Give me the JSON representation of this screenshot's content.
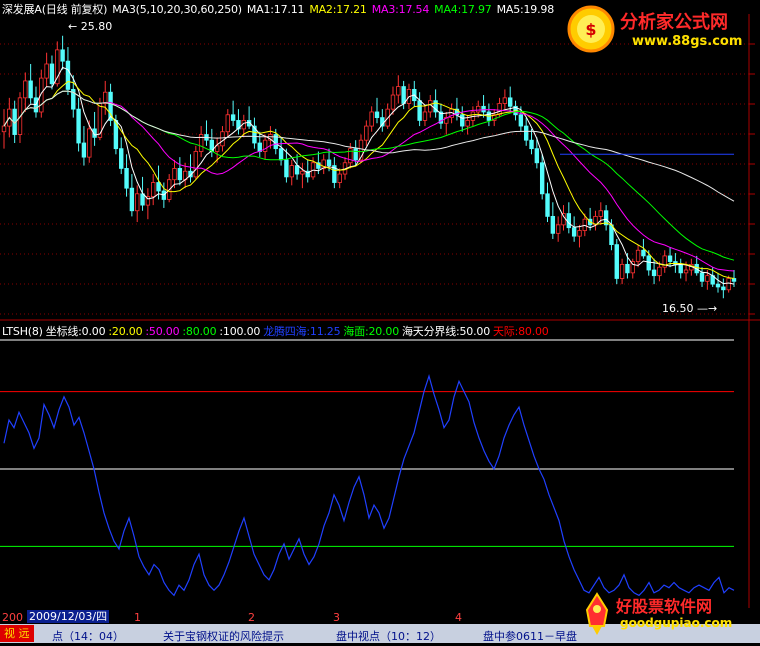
{
  "header": {
    "stock": "深发展A(日线 前复权)",
    "ma_params": "MA3(5,10,20,30,60,250)",
    "ma1": "MA1:17.11",
    "ma2": "MA2:17.21",
    "ma3": "MA3:17.54",
    "ma4": "MA4:17.97",
    "ma5": "MA5:19.98"
  },
  "indicator_header": {
    "name": "LTSH(8)",
    "coord": "坐标线:0.00",
    "c20": ":20.00",
    "c50": ":50.00",
    "c80": ":80.00",
    "c100": ":100.00",
    "longteng": "龙腾四海:11.25",
    "haimian": "海面:20.00",
    "fenjie": "海天分界线:50.00",
    "tianji": "天际:80.00"
  },
  "annotations": {
    "high": "25.80",
    "low": "16.50"
  },
  "colors": {
    "ma1": "#ffffff",
    "ma2": "#ffff00",
    "ma3": "#ff00ff",
    "ma4": "#00ff00",
    "ma5": "#ffffff",
    "up": "#ff3232",
    "down": "#54fcfc",
    "ltsh": "#2040ff",
    "haimian": "#00ff00",
    "fenjie": "#ffffff",
    "tianji": "#ff0000"
  },
  "bottom": {
    "year": "200",
    "date": "2009/12/03/四",
    "months": [
      "1",
      "2",
      "3",
      "4"
    ],
    "tab": "视 远",
    "news": [
      "点（14：04）",
      "关于宝钢权证的风险提示",
      "盘中视点（10：12）",
      "盘中参0611－早盘"
    ]
  },
  "logos": {
    "top_title": "分析家公式网",
    "top_url": "www.88gs.com",
    "bottom_title": "好股票软件网",
    "bottom_url": "goodgupiao.com"
  },
  "chart_data": [
    {
      "type": "candlestick",
      "title": "",
      "ylim": [
        15.8,
        26.5
      ],
      "candles_ohlc": [
        [
          22.4,
          23.2,
          21.8,
          22.6
        ],
        [
          22.6,
          23.6,
          22.2,
          23.2
        ],
        [
          23.2,
          23.5,
          22.0,
          22.3
        ],
        [
          22.3,
          23.8,
          22.0,
          23.6
        ],
        [
          23.6,
          24.5,
          23.1,
          24.2
        ],
        [
          24.2,
          24.8,
          23.4,
          23.6
        ],
        [
          23.6,
          24.0,
          22.9,
          23.1
        ],
        [
          23.1,
          24.6,
          22.9,
          24.3
        ],
        [
          24.3,
          25.2,
          24.0,
          24.8
        ],
        [
          24.8,
          25.1,
          23.9,
          24.1
        ],
        [
          24.1,
          25.6,
          24.0,
          25.3
        ],
        [
          25.3,
          25.8,
          24.6,
          24.9
        ],
        [
          24.9,
          25.4,
          23.7,
          23.9
        ],
        [
          23.9,
          24.4,
          22.9,
          23.2
        ],
        [
          23.2,
          23.6,
          21.7,
          22.0
        ],
        [
          22.0,
          22.6,
          21.2,
          21.5
        ],
        [
          21.5,
          22.8,
          21.3,
          22.5
        ],
        [
          22.5,
          23.1,
          21.9,
          22.2
        ],
        [
          22.2,
          23.6,
          22.1,
          23.4
        ],
        [
          23.4,
          24.2,
          23.0,
          23.8
        ],
        [
          23.8,
          24.1,
          22.6,
          22.8
        ],
        [
          22.8,
          23.0,
          21.6,
          21.8
        ],
        [
          21.8,
          22.2,
          20.9,
          21.1
        ],
        [
          21.1,
          21.6,
          20.1,
          20.4
        ],
        [
          20.4,
          20.9,
          19.4,
          19.6
        ],
        [
          19.6,
          20.5,
          19.2,
          20.2
        ],
        [
          20.2,
          20.8,
          19.6,
          19.8
        ],
        [
          19.8,
          20.4,
          19.3,
          20.1
        ],
        [
          20.1,
          20.9,
          19.8,
          20.6
        ],
        [
          20.6,
          21.2,
          20.0,
          20.3
        ],
        [
          20.3,
          20.6,
          19.7,
          20.0
        ],
        [
          20.0,
          20.9,
          19.9,
          20.7
        ],
        [
          20.7,
          21.4,
          20.4,
          21.1
        ],
        [
          21.1,
          21.5,
          20.5,
          20.7
        ],
        [
          20.7,
          21.3,
          20.4,
          21.0
        ],
        [
          21.0,
          21.6,
          20.6,
          20.8
        ],
        [
          20.8,
          21.9,
          20.7,
          21.7
        ],
        [
          21.7,
          22.6,
          21.5,
          22.3
        ],
        [
          22.3,
          22.8,
          21.9,
          22.1
        ],
        [
          22.1,
          22.5,
          21.5,
          21.7
        ],
        [
          21.7,
          22.2,
          21.3,
          21.9
        ],
        [
          21.9,
          22.6,
          21.7,
          22.4
        ],
        [
          22.4,
          23.2,
          22.2,
          23.0
        ],
        [
          23.0,
          23.5,
          22.6,
          22.8
        ],
        [
          22.8,
          23.2,
          22.3,
          22.5
        ],
        [
          22.5,
          23.0,
          22.2,
          22.8
        ],
        [
          22.8,
          23.3,
          22.5,
          22.6
        ],
        [
          22.6,
          22.9,
          21.8,
          22.0
        ],
        [
          22.0,
          22.4,
          21.5,
          21.7
        ],
        [
          21.7,
          22.3,
          21.4,
          22.1
        ],
        [
          22.1,
          22.6,
          21.8,
          22.3
        ],
        [
          22.3,
          22.5,
          21.6,
          21.8
        ],
        [
          21.8,
          22.2,
          21.2,
          21.4
        ],
        [
          21.4,
          21.8,
          20.6,
          20.8
        ],
        [
          20.8,
          21.4,
          20.5,
          21.2
        ],
        [
          21.2,
          21.6,
          20.7,
          20.9
        ],
        [
          20.9,
          21.3,
          20.4,
          21.0
        ],
        [
          21.0,
          21.4,
          20.6,
          20.8
        ],
        [
          20.8,
          21.5,
          20.7,
          21.3
        ],
        [
          21.3,
          21.7,
          20.9,
          21.1
        ],
        [
          21.1,
          21.6,
          20.9,
          21.4
        ],
        [
          21.4,
          21.8,
          21.0,
          21.2
        ],
        [
          21.2,
          21.5,
          20.4,
          20.6
        ],
        [
          20.6,
          21.1,
          20.4,
          20.9
        ],
        [
          20.9,
          21.5,
          20.7,
          21.3
        ],
        [
          21.3,
          22.0,
          21.1,
          21.8
        ],
        [
          21.8,
          22.1,
          21.2,
          21.4
        ],
        [
          21.4,
          22.3,
          21.3,
          22.1
        ],
        [
          22.1,
          22.8,
          21.9,
          22.6
        ],
        [
          22.6,
          23.3,
          22.4,
          23.1
        ],
        [
          23.1,
          23.6,
          22.7,
          22.9
        ],
        [
          22.9,
          23.2,
          22.4,
          22.6
        ],
        [
          22.6,
          23.4,
          22.5,
          23.2
        ],
        [
          23.2,
          24.0,
          23.0,
          23.7
        ],
        [
          23.7,
          24.4,
          23.4,
          24.0
        ],
        [
          24.0,
          24.2,
          23.2,
          23.4
        ],
        [
          23.4,
          24.1,
          23.2,
          23.9
        ],
        [
          23.9,
          24.2,
          23.3,
          23.5
        ],
        [
          23.5,
          23.8,
          22.6,
          22.8
        ],
        [
          22.8,
          23.3,
          22.6,
          23.1
        ],
        [
          23.1,
          23.7,
          22.9,
          23.5
        ],
        [
          23.5,
          23.9,
          22.9,
          23.1
        ],
        [
          23.1,
          23.4,
          22.5,
          22.7
        ],
        [
          22.7,
          23.1,
          22.3,
          22.9
        ],
        [
          22.9,
          23.4,
          22.7,
          23.2
        ],
        [
          23.2,
          23.6,
          22.8,
          23.0
        ],
        [
          23.0,
          23.3,
          22.4,
          22.6
        ],
        [
          22.6,
          23.0,
          22.3,
          22.8
        ],
        [
          22.8,
          23.3,
          22.6,
          23.1
        ],
        [
          23.1,
          23.5,
          22.9,
          23.3
        ],
        [
          23.3,
          23.7,
          22.9,
          23.1
        ],
        [
          23.1,
          23.4,
          22.6,
          22.8
        ],
        [
          22.8,
          23.2,
          22.6,
          23.0
        ],
        [
          23.0,
          23.6,
          22.9,
          23.4
        ],
        [
          23.4,
          23.9,
          23.2,
          23.6
        ],
        [
          23.6,
          24.0,
          23.1,
          23.3
        ],
        [
          23.3,
          23.5,
          22.8,
          23.0
        ],
        [
          23.0,
          23.3,
          22.4,
          22.6
        ],
        [
          22.6,
          22.9,
          21.9,
          22.1
        ],
        [
          22.1,
          22.5,
          21.6,
          21.8
        ],
        [
          21.8,
          22.2,
          21.1,
          21.3
        ],
        [
          21.3,
          21.6,
          20.0,
          20.2
        ],
        [
          20.2,
          20.6,
          19.2,
          19.4
        ],
        [
          19.4,
          19.9,
          18.6,
          18.8
        ],
        [
          18.8,
          19.4,
          18.5,
          19.1
        ],
        [
          19.1,
          19.8,
          18.9,
          19.5
        ],
        [
          19.5,
          19.9,
          18.8,
          19.0
        ],
        [
          19.0,
          19.4,
          18.5,
          18.7
        ],
        [
          18.7,
          19.1,
          18.3,
          18.9
        ],
        [
          18.9,
          19.5,
          18.7,
          19.3
        ],
        [
          19.3,
          19.7,
          18.9,
          19.1
        ],
        [
          19.1,
          19.6,
          18.9,
          19.4
        ],
        [
          19.4,
          19.9,
          19.1,
          19.6
        ],
        [
          19.6,
          19.8,
          18.9,
          19.1
        ],
        [
          19.1,
          19.3,
          18.2,
          18.4
        ],
        [
          18.4,
          18.6,
          17.0,
          17.2
        ],
        [
          17.2,
          17.9,
          17.0,
          17.7
        ],
        [
          17.7,
          18.1,
          17.2,
          17.4
        ],
        [
          17.4,
          17.9,
          17.2,
          17.8
        ],
        [
          17.8,
          18.4,
          17.6,
          18.2
        ],
        [
          18.2,
          18.6,
          17.9,
          18.0
        ],
        [
          18.0,
          18.2,
          17.3,
          17.5
        ],
        [
          17.5,
          17.9,
          17.0,
          17.3
        ],
        [
          17.3,
          17.8,
          17.1,
          17.6
        ],
        [
          17.6,
          18.2,
          17.4,
          18.0
        ],
        [
          18.0,
          18.3,
          17.6,
          17.8
        ],
        [
          17.8,
          18.1,
          17.4,
          17.7
        ],
        [
          17.7,
          17.9,
          17.2,
          17.4
        ],
        [
          17.4,
          17.8,
          17.1,
          17.5
        ],
        [
          17.5,
          17.9,
          17.3,
          17.7
        ],
        [
          17.7,
          18.0,
          17.3,
          17.4
        ],
        [
          17.4,
          17.6,
          16.9,
          17.1
        ],
        [
          17.1,
          17.5,
          16.8,
          17.3
        ],
        [
          17.3,
          17.6,
          16.9,
          17.0
        ],
        [
          17.0,
          17.4,
          16.7,
          16.9
        ],
        [
          16.9,
          17.2,
          16.5,
          16.8
        ],
        [
          16.8,
          17.3,
          16.7,
          17.2
        ],
        [
          17.2,
          17.5,
          16.9,
          17.1
        ]
      ]
    },
    {
      "type": "line",
      "title": "",
      "ylim": [
        0,
        100
      ],
      "series": [
        {
          "name": "龙腾四海",
          "values": [
            60,
            69,
            66,
            72,
            68,
            64,
            58,
            62,
            75,
            71,
            66,
            73,
            78,
            74,
            67,
            70,
            64,
            57,
            50,
            41,
            33,
            27,
            22,
            19,
            26,
            31,
            24,
            16,
            12,
            9,
            13,
            11,
            6,
            3,
            1,
            5,
            3,
            7,
            13,
            17,
            9,
            5,
            3,
            5,
            9,
            14,
            20,
            26,
            31,
            24,
            17,
            13,
            9,
            7,
            11,
            17,
            21,
            15,
            19,
            23,
            17,
            13,
            16,
            21,
            28,
            33,
            40,
            36,
            30,
            37,
            43,
            47,
            40,
            31,
            36,
            33,
            27,
            31,
            39,
            47,
            54,
            59,
            64,
            72,
            80,
            86,
            79,
            73,
            66,
            69,
            78,
            84,
            80,
            76,
            68,
            62,
            57,
            53,
            50,
            55,
            62,
            67,
            71,
            74,
            67,
            61,
            55,
            50,
            46,
            40,
            35,
            30,
            22,
            16,
            11,
            7,
            3,
            2,
            5,
            8,
            4,
            2,
            3,
            5,
            9,
            4,
            2,
            1,
            3,
            6,
            2,
            3,
            5,
            4,
            6,
            4,
            3,
            2,
            4,
            5,
            4,
            3,
            6,
            8,
            2,
            4,
            3
          ]
        }
      ],
      "reference_lines": [
        20,
        50,
        80,
        100
      ]
    }
  ]
}
